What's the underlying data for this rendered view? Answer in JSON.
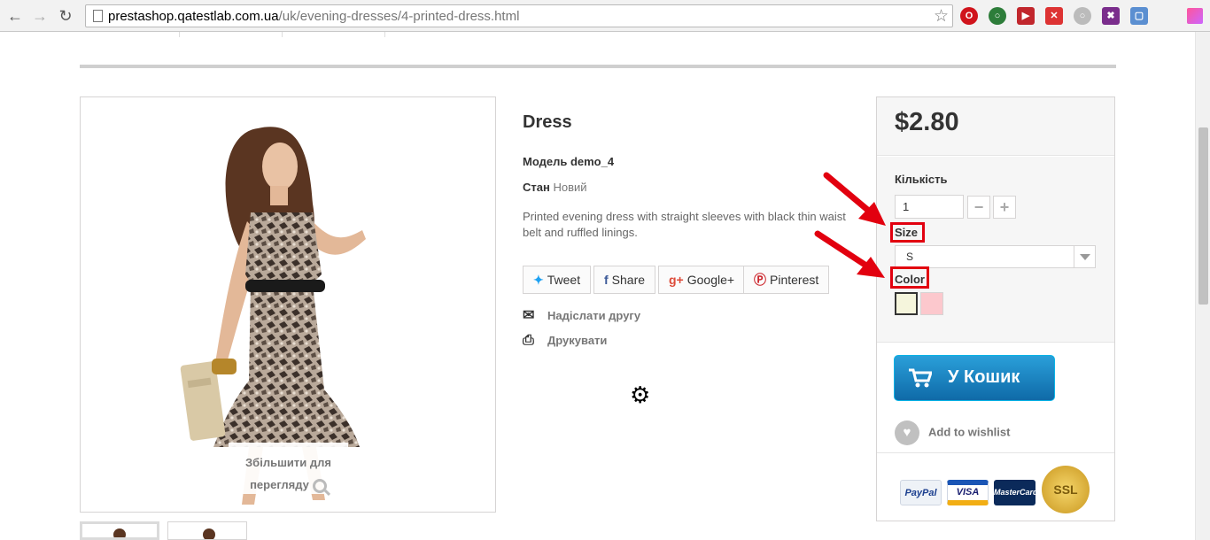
{
  "browser": {
    "url_host": "prestashop.qatestlab.com.ua",
    "url_path": "/uk/evening-dresses/4-printed-dress.html"
  },
  "product": {
    "title": "Dress",
    "reference": "Модель demo_4",
    "condition_label": "Стан",
    "condition_value": "Новий",
    "description": "Printed evening dress with straight sleeves with black thin waist belt and ruffled linings.",
    "zoom_label_1": "Збільшити для",
    "zoom_label_2": "перегляду"
  },
  "social": {
    "tweet": "Tweet",
    "share": "Share",
    "google": "Google+",
    "pinterest": "Pinterest"
  },
  "actions": {
    "send_friend": "Надіслати другу",
    "print": "Друкувати"
  },
  "buy_box": {
    "price": "$2.80",
    "quantity_label": "Кількість",
    "quantity_value": "1",
    "size_label": "Size",
    "size_value": "S",
    "color_label": "Color",
    "colors": [
      "#f5f5dc",
      "#fcc8cd"
    ],
    "add_to_cart": "У Кошик",
    "wishlist": "Add to wishlist"
  },
  "payment": {
    "paypal": "PayPal",
    "visa": "VISA",
    "mastercard": "MasterCard",
    "ssl": "SSL"
  },
  "colors": {
    "accent_blue": "#1e8ccc",
    "highlight_red": "#e2000f"
  }
}
